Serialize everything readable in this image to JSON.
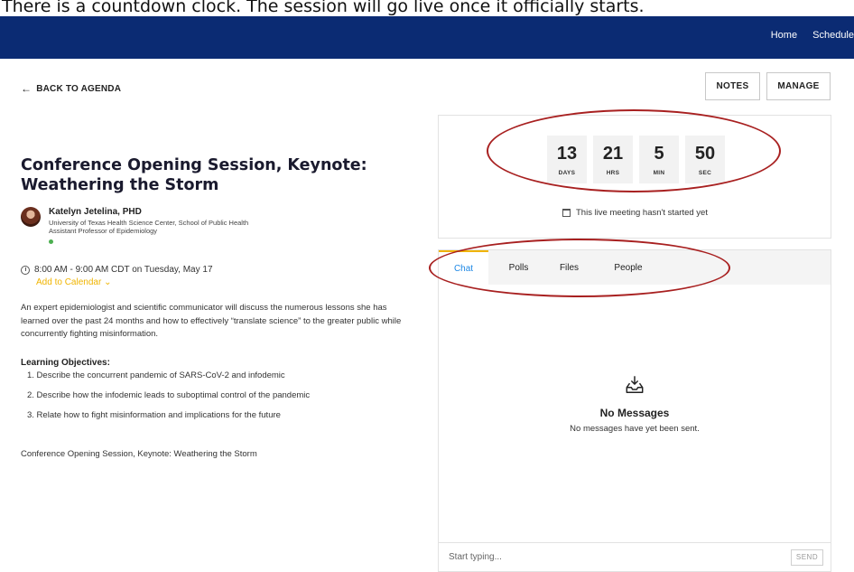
{
  "caption": "There is a countdown clock. The session will go live once it officially starts.",
  "nav": {
    "items": [
      "Home",
      "Schedule"
    ]
  },
  "back_link": "BACK TO AGENDA",
  "buttons": {
    "notes": "NOTES",
    "manage": "MANAGE"
  },
  "session": {
    "title": "Conference Opening Session, Keynote: Weathering the Storm",
    "speaker": {
      "name": "Katelyn Jetelina, PHD",
      "affiliation": "University of Texas Health Science Center, School of Public Health",
      "role": "Assistant Professor of Epidemiology",
      "status_color": "#4caf50"
    },
    "time": "8:00 AM - 9:00 AM CDT on Tuesday, May 17",
    "add_to_calendar": "Add to Calendar",
    "description": "An expert epidemiologist and scientific communicator will discuss the numerous lessons she has learned over the past 24 months and how to effectively “translate science” to the greater public while concurrently fighting misinformation.",
    "learning_objectives_title": "Learning Objectives:",
    "learning_objectives": [
      "1. Describe the concurrent pandemic of SARS-CoV-2 and infodemic",
      "2. Describe how the infodemic leads to suboptimal control of the pandemic",
      "3. Relate how to fight misinformation and implications for the future"
    ],
    "footer": "Conference Opening Session, Keynote: Weathering the Storm"
  },
  "countdown": {
    "units": [
      {
        "value": "13",
        "label": "DAYS"
      },
      {
        "value": "21",
        "label": "HRS"
      },
      {
        "value": "5",
        "label": "MIN"
      },
      {
        "value": "50",
        "label": "SEC"
      }
    ],
    "status": "This live meeting hasn't started yet"
  },
  "chat": {
    "tabs": [
      {
        "label": "Chat",
        "active": true
      },
      {
        "label": "Polls",
        "active": false
      },
      {
        "label": "Files",
        "active": false
      },
      {
        "label": "People",
        "active": false
      }
    ],
    "empty_title": "No Messages",
    "empty_subtitle": "No messages have yet been sent.",
    "input_placeholder": "Start typing...",
    "send_label": "SEND"
  },
  "colors": {
    "topbar": "#0b2b73",
    "accent": "#f0b400",
    "link": "#1e88e5",
    "annotation": "#a82020"
  }
}
